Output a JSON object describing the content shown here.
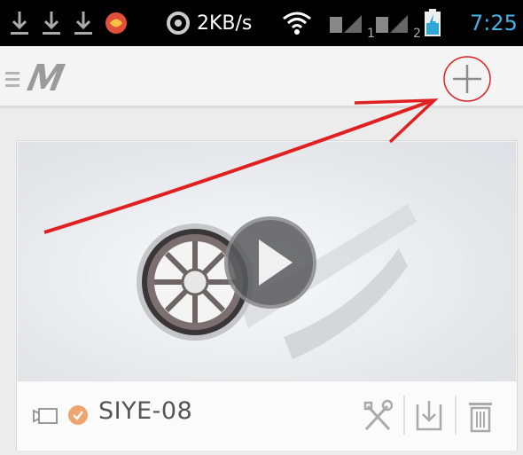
{
  "status_bar": {
    "network_speed": "2KB/s",
    "sim1_label": "1",
    "sim2_label": "2",
    "time": "7:25",
    "icons": [
      "download-icon",
      "download-icon",
      "download-icon",
      "app-notification-icon",
      "sync-icon",
      "wifi-icon",
      "signal-icon",
      "signal-icon",
      "battery-charging-icon"
    ]
  },
  "app_bar": {
    "logo_text": "M",
    "menu_icon": "menu-icon",
    "add_icon": "plus-icon"
  },
  "card": {
    "title": "SIYE-08",
    "thumbnail_icons": [
      "film-reel-icon",
      "play-icon"
    ],
    "actions": [
      "settings-tools-icon",
      "download-icon",
      "delete-icon"
    ]
  },
  "colors": {
    "status_bar_bg": "#000000",
    "time_color": "#47b0e6",
    "app_bar_bg": "#f4f4f4",
    "annotation_red": "#e02020",
    "status_dot": "#f0a36c"
  }
}
